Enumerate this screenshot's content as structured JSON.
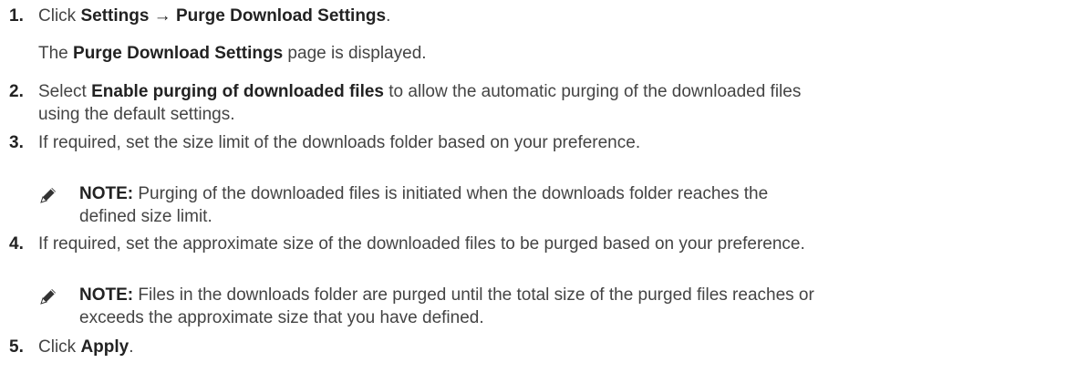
{
  "steps": [
    {
      "number": "1.",
      "pre": "Click ",
      "bold1": "Settings",
      "arrow": " → ",
      "bold2": "Purge Download Settings",
      "post": ".",
      "result_pre": "The ",
      "result_bold": "Purge Download Settings",
      "result_post": " page is displayed."
    },
    {
      "number": "2.",
      "pre": "Select ",
      "bold": "Enable purging of downloaded files",
      "post_line1": " to allow the automatic purging of the downloaded files",
      "line2": "using the default settings."
    },
    {
      "number": "3.",
      "text": "If required, set the size limit of the downloads folder based on your preference.",
      "note_label": "NOTE:",
      "note_line1": " Purging of the downloaded files is initiated when the downloads folder reaches the",
      "note_line2": "defined size limit."
    },
    {
      "number": "4.",
      "text": "If required, set the approximate size of the downloaded files to be purged based on your preference.",
      "note_label": "NOTE:",
      "note_line1": " Files in the downloads folder are purged until the total size of the purged files reaches or",
      "note_line2": "exceeds the approximate size that you have defined."
    },
    {
      "number": "5.",
      "pre": "Click ",
      "bold": "Apply",
      "post": "."
    }
  ],
  "icons": {
    "note": "pencil-note-icon"
  },
  "colors": {
    "text": "#444444",
    "bold": "#222222"
  }
}
